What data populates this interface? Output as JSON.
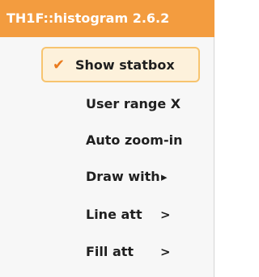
{
  "menu": {
    "title": "TH1F::histogram 2.6.2",
    "items": [
      {
        "label": "Show statbox",
        "selected": true
      },
      {
        "label": "User range X"
      },
      {
        "label": "Auto zoom-in"
      },
      {
        "label": "Draw with",
        "submenu_glyph": "▸"
      },
      {
        "label": "Line att",
        "submenu_glyph": ">"
      },
      {
        "label": "Fill att",
        "submenu_glyph": ">"
      }
    ]
  },
  "icons": {
    "check": "check-icon",
    "submenu": "chevron-right-icon"
  },
  "colors": {
    "header_bg": "#f39c3f",
    "selected_bg": "#fdf1db",
    "selected_border": "#f7c46f",
    "check": "#ea7a1d"
  }
}
